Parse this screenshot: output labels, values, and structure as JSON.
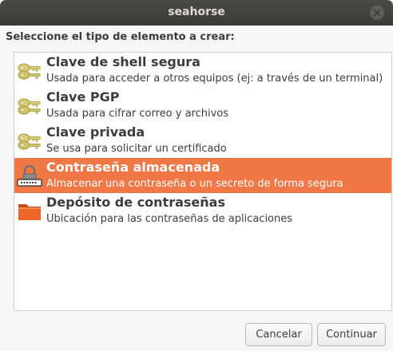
{
  "window": {
    "title": "seahorse"
  },
  "prompt": "Seleccione el tipo de elemento a crear:",
  "items": [
    {
      "name": "Clave de shell segura",
      "description": "Usada para acceder a otros equipos (ej: a través de un terminal)",
      "icon": "key-icon",
      "selected": false
    },
    {
      "name": "Clave PGP",
      "description": "Usada para cifrar correo y archivos",
      "icon": "key-icon",
      "selected": false
    },
    {
      "name": "Clave privada",
      "description": "Se usa para solicitar un certificado",
      "icon": "key-icon",
      "selected": false
    },
    {
      "name": "Contraseña almacenada",
      "description": "Almacenar una contraseña o un secreto de forma segura",
      "icon": "password-lock-icon",
      "selected": true
    },
    {
      "name": "Depósito de contraseñas",
      "description": "Ubicación para las contraseñas de aplicaciones",
      "icon": "folder-icon",
      "selected": false
    }
  ],
  "buttons": {
    "cancel": "Cancelar",
    "continue": "Continuar"
  },
  "colors": {
    "titlebar": "#3c3b37",
    "selection": "#f07746",
    "background": "#f6f6f6"
  }
}
